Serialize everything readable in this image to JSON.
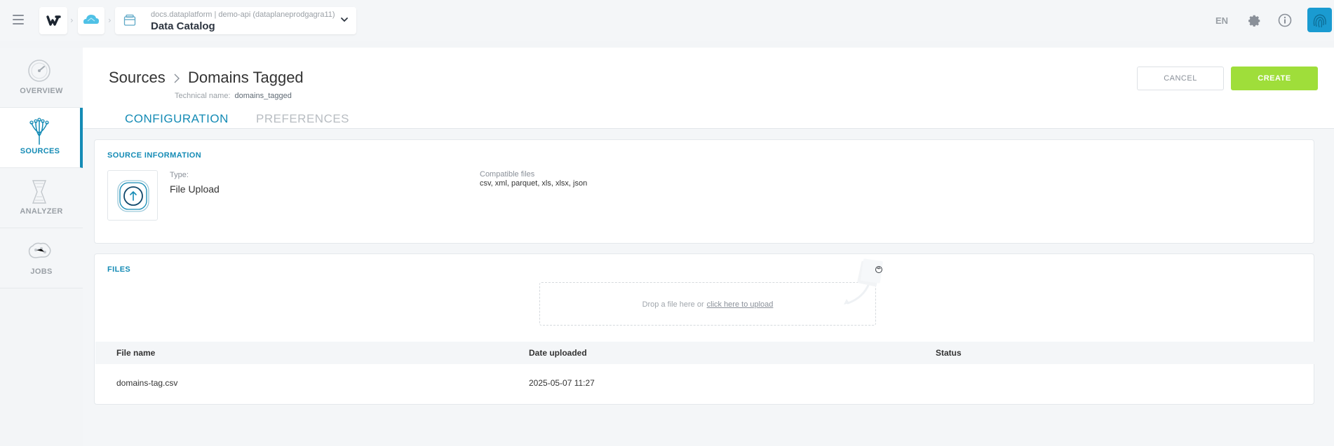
{
  "header": {
    "workspace_path": "docs.dataplatform  |  demo-api (dataplaneprodgagra11)",
    "app_title": "Data Catalog",
    "language": "EN",
    "colors": {
      "accent": "#148bb5",
      "create": "#9fde3a",
      "avatar": "#1a9bd1"
    }
  },
  "sidebar": {
    "items": [
      {
        "label": "OVERVIEW",
        "icon": "gauge-icon"
      },
      {
        "label": "SOURCES",
        "icon": "sources-tree-icon",
        "active": true
      },
      {
        "label": "ANALYZER",
        "icon": "analyzer-funnel-icon"
      },
      {
        "label": "JOBS",
        "icon": "jobs-brain-icon"
      }
    ]
  },
  "page": {
    "breadcrumb_parent": "Sources",
    "title": "Domains Tagged",
    "technical_label": "Technical name:",
    "technical_value": "domains_tagged",
    "cancel_label": "CANCEL",
    "create_label": "CREATE",
    "tabs": [
      {
        "label": "CONFIGURATION",
        "active": true
      },
      {
        "label": "PREFERENCES",
        "active": false
      }
    ]
  },
  "source_info": {
    "heading": "SOURCE INFORMATION",
    "type_label": "Type:",
    "type_value": "File Upload",
    "compatible_label": "Compatible files",
    "compatible_value": "csv, xml, parquet, xls, xlsx, json"
  },
  "files": {
    "heading": "FILES",
    "drop_text": "Drop a file here  or",
    "upload_link": "click here to upload",
    "columns": [
      "File name",
      "Date uploaded",
      "Status"
    ],
    "rows": [
      {
        "name": "domains-tag.csv",
        "date": "2025-05-07 11:27",
        "status": ""
      }
    ]
  }
}
